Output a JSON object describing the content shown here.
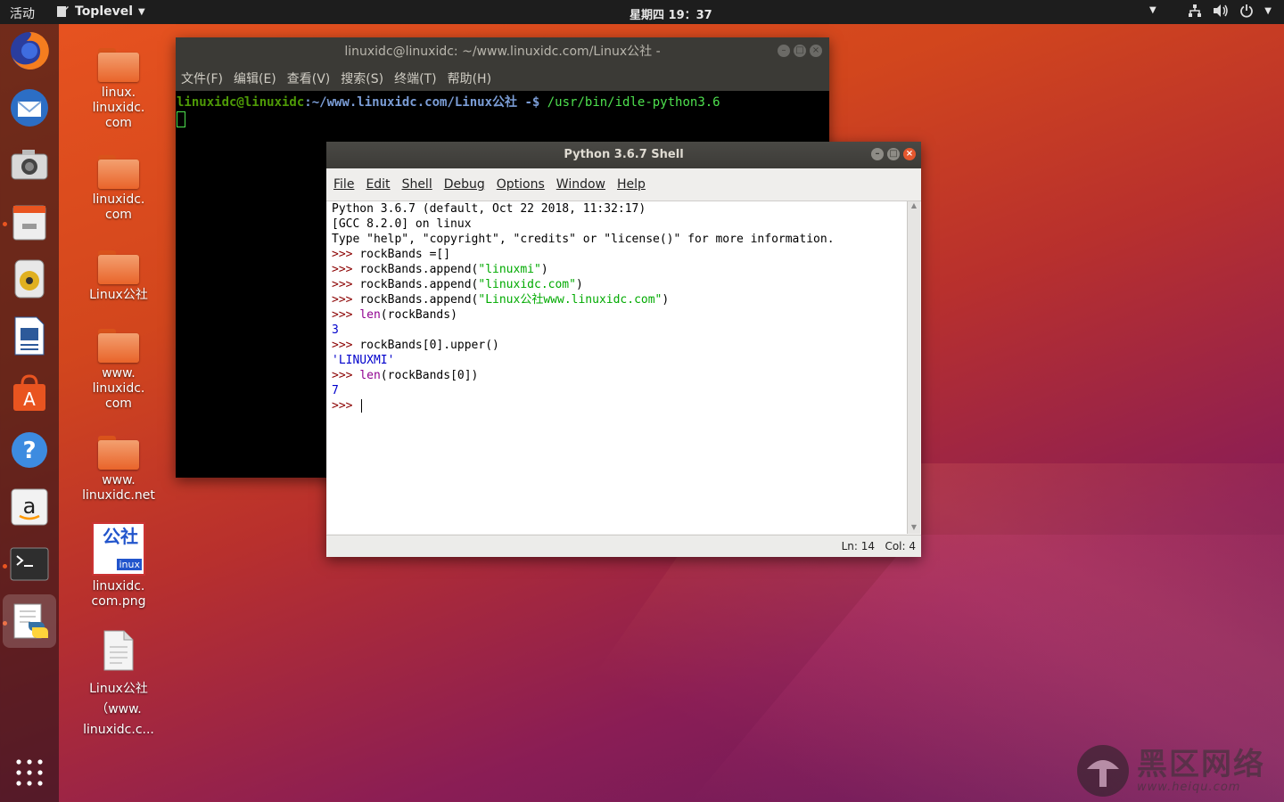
{
  "topbar": {
    "activities": "活动",
    "app_name": "Toplevel",
    "clock": "星期四 19：37"
  },
  "desktop_icons": [
    {
      "label": "linux.\nlinuxidc.\ncom"
    },
    {
      "label": "linuxidc.\ncom"
    },
    {
      "label": "Linux公社"
    },
    {
      "label": "www.\nlinuxidc.\ncom"
    },
    {
      "label": "www.\nlinuxidc.net"
    },
    {
      "label": "linuxidc.\ncom.png"
    },
    {
      "label": "Linux公社\n（www.\nlinuxidc.c..."
    }
  ],
  "png_thumb": {
    "top": "公社",
    "bottom": "inux"
  },
  "terminal": {
    "title": "linuxidc@linuxidc: ~/www.linuxidc.com/Linux公社 -",
    "menu": [
      "文件(F)",
      "编辑(E)",
      "查看(V)",
      "搜索(S)",
      "终端(T)",
      "帮助(H)"
    ],
    "prompt_user": "linuxidc@linuxidc",
    "prompt_path": ":~/www.linuxidc.com/Linux公社 -$",
    "command": " /usr/bin/idle-python3.6"
  },
  "idle": {
    "title": "Python 3.6.7 Shell",
    "menu": [
      "File",
      "Edit",
      "Shell",
      "Debug",
      "Options",
      "Window",
      "Help"
    ],
    "lines": [
      {
        "parts": [
          {
            "t": "Python 3.6.7 (default, Oct 22 2018, 11:32:17)",
            "c": "#000"
          }
        ]
      },
      {
        "parts": [
          {
            "t": "[GCC 8.2.0] on linux",
            "c": "#000"
          }
        ]
      },
      {
        "parts": [
          {
            "t": "Type \"help\", \"copyright\", \"credits\" or \"license()\" for more information.",
            "c": "#000"
          }
        ]
      },
      {
        "parts": [
          {
            "t": ">>> ",
            "c": "#8b0000"
          },
          {
            "t": "rockBands =[]",
            "c": "#000"
          }
        ]
      },
      {
        "parts": [
          {
            "t": ">>> ",
            "c": "#8b0000"
          },
          {
            "t": "rockBands.append(",
            "c": "#000"
          },
          {
            "t": "\"linuxmi\"",
            "c": "#00aa00"
          },
          {
            "t": ")",
            "c": "#000"
          }
        ]
      },
      {
        "parts": [
          {
            "t": ">>> ",
            "c": "#8b0000"
          },
          {
            "t": "rockBands.append(",
            "c": "#000"
          },
          {
            "t": "\"linuxidc.com\"",
            "c": "#00aa00"
          },
          {
            "t": ")",
            "c": "#000"
          }
        ]
      },
      {
        "parts": [
          {
            "t": ">>> ",
            "c": "#8b0000"
          },
          {
            "t": "rockBands.append(",
            "c": "#000"
          },
          {
            "t": "\"Linux公社www.linuxidc.com\"",
            "c": "#00aa00"
          },
          {
            "t": ")",
            "c": "#000"
          }
        ]
      },
      {
        "parts": [
          {
            "t": ">>> ",
            "c": "#8b0000"
          },
          {
            "t": "len",
            "c": "#900090"
          },
          {
            "t": "(rockBands)",
            "c": "#000"
          }
        ]
      },
      {
        "parts": [
          {
            "t": "3",
            "c": "#0000cc"
          }
        ]
      },
      {
        "parts": [
          {
            "t": ">>> ",
            "c": "#8b0000"
          },
          {
            "t": "rockBands[0].upper()",
            "c": "#000"
          }
        ]
      },
      {
        "parts": [
          {
            "t": "'LINUXMI'",
            "c": "#0000cc"
          }
        ]
      },
      {
        "parts": [
          {
            "t": ">>> ",
            "c": "#8b0000"
          },
          {
            "t": "len",
            "c": "#900090"
          },
          {
            "t": "(rockBands[0])",
            "c": "#000"
          }
        ]
      },
      {
        "parts": [
          {
            "t": "7",
            "c": "#0000cc"
          }
        ]
      },
      {
        "parts": [
          {
            "t": ">>> ",
            "c": "#8b0000"
          }
        ]
      }
    ],
    "status": "Ln: 14   Col: 4"
  },
  "watermark": {
    "text": "黑区网络",
    "sub": "www.heiqu.com"
  },
  "colors": {
    "ubuntu_orange": "#e95420",
    "prompt_green": "#4e9a06",
    "prompt_blue": "#7b9dd6"
  }
}
